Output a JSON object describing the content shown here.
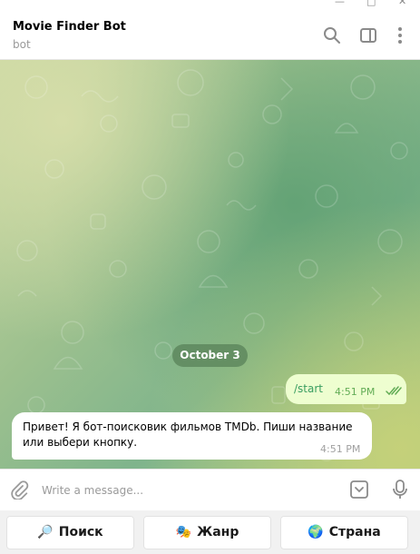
{
  "header": {
    "title": "Movie Finder Bot",
    "subtitle": "bot",
    "icons": [
      "search-icon",
      "sidebar-toggle-icon",
      "more-vertical-icon"
    ]
  },
  "window_controls": {
    "minimize": "—",
    "maximize": "□",
    "close": "✕"
  },
  "chat": {
    "date_separator": "October 3",
    "messages": [
      {
        "direction": "outgoing",
        "text": "/start",
        "time": "4:51 PM",
        "status": "read"
      },
      {
        "direction": "incoming",
        "text": "Привет! Я бот-поисковик фильмов TMDb. Пиши название или выбери кнопку.",
        "time": "4:51 PM"
      }
    ]
  },
  "composer": {
    "placeholder": "Write a message...",
    "icons": [
      "attach-icon",
      "keyboard-toggle-icon",
      "microphone-icon"
    ]
  },
  "keyboard": {
    "buttons": [
      {
        "emoji": "🔎",
        "label": "Поиск"
      },
      {
        "emoji": "🎭",
        "label": "Жанр"
      },
      {
        "emoji": "🌍",
        "label": "Страна"
      }
    ]
  },
  "colors": {
    "outgoing_bubble": "#eefed0",
    "incoming_bubble": "#ffffff",
    "date_pill": "#588258",
    "read_check": "#62ac55",
    "keyboard_bg": "#f1f1f1"
  }
}
